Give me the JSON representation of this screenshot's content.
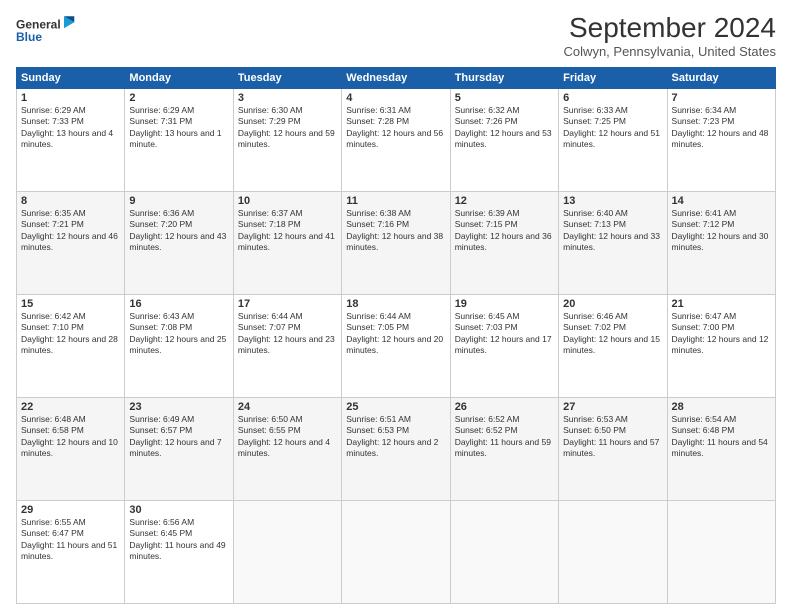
{
  "logo": {
    "line1": "General",
    "line2": "Blue"
  },
  "title": "September 2024",
  "subtitle": "Colwyn, Pennsylvania, United States",
  "days_of_week": [
    "Sunday",
    "Monday",
    "Tuesday",
    "Wednesday",
    "Thursday",
    "Friday",
    "Saturday"
  ],
  "weeks": [
    [
      {
        "day": "1",
        "sunrise": "6:29 AM",
        "sunset": "7:33 PM",
        "daylight": "13 hours and 4 minutes."
      },
      {
        "day": "2",
        "sunrise": "6:29 AM",
        "sunset": "7:31 PM",
        "daylight": "13 hours and 1 minute."
      },
      {
        "day": "3",
        "sunrise": "6:30 AM",
        "sunset": "7:29 PM",
        "daylight": "12 hours and 59 minutes."
      },
      {
        "day": "4",
        "sunrise": "6:31 AM",
        "sunset": "7:28 PM",
        "daylight": "12 hours and 56 minutes."
      },
      {
        "day": "5",
        "sunrise": "6:32 AM",
        "sunset": "7:26 PM",
        "daylight": "12 hours and 53 minutes."
      },
      {
        "day": "6",
        "sunrise": "6:33 AM",
        "sunset": "7:25 PM",
        "daylight": "12 hours and 51 minutes."
      },
      {
        "day": "7",
        "sunrise": "6:34 AM",
        "sunset": "7:23 PM",
        "daylight": "12 hours and 48 minutes."
      }
    ],
    [
      {
        "day": "8",
        "sunrise": "6:35 AM",
        "sunset": "7:21 PM",
        "daylight": "12 hours and 46 minutes."
      },
      {
        "day": "9",
        "sunrise": "6:36 AM",
        "sunset": "7:20 PM",
        "daylight": "12 hours and 43 minutes."
      },
      {
        "day": "10",
        "sunrise": "6:37 AM",
        "sunset": "7:18 PM",
        "daylight": "12 hours and 41 minutes."
      },
      {
        "day": "11",
        "sunrise": "6:38 AM",
        "sunset": "7:16 PM",
        "daylight": "12 hours and 38 minutes."
      },
      {
        "day": "12",
        "sunrise": "6:39 AM",
        "sunset": "7:15 PM",
        "daylight": "12 hours and 36 minutes."
      },
      {
        "day": "13",
        "sunrise": "6:40 AM",
        "sunset": "7:13 PM",
        "daylight": "12 hours and 33 minutes."
      },
      {
        "day": "14",
        "sunrise": "6:41 AM",
        "sunset": "7:12 PM",
        "daylight": "12 hours and 30 minutes."
      }
    ],
    [
      {
        "day": "15",
        "sunrise": "6:42 AM",
        "sunset": "7:10 PM",
        "daylight": "12 hours and 28 minutes."
      },
      {
        "day": "16",
        "sunrise": "6:43 AM",
        "sunset": "7:08 PM",
        "daylight": "12 hours and 25 minutes."
      },
      {
        "day": "17",
        "sunrise": "6:44 AM",
        "sunset": "7:07 PM",
        "daylight": "12 hours and 23 minutes."
      },
      {
        "day": "18",
        "sunrise": "6:44 AM",
        "sunset": "7:05 PM",
        "daylight": "12 hours and 20 minutes."
      },
      {
        "day": "19",
        "sunrise": "6:45 AM",
        "sunset": "7:03 PM",
        "daylight": "12 hours and 17 minutes."
      },
      {
        "day": "20",
        "sunrise": "6:46 AM",
        "sunset": "7:02 PM",
        "daylight": "12 hours and 15 minutes."
      },
      {
        "day": "21",
        "sunrise": "6:47 AM",
        "sunset": "7:00 PM",
        "daylight": "12 hours and 12 minutes."
      }
    ],
    [
      {
        "day": "22",
        "sunrise": "6:48 AM",
        "sunset": "6:58 PM",
        "daylight": "12 hours and 10 minutes."
      },
      {
        "day": "23",
        "sunrise": "6:49 AM",
        "sunset": "6:57 PM",
        "daylight": "12 hours and 7 minutes."
      },
      {
        "day": "24",
        "sunrise": "6:50 AM",
        "sunset": "6:55 PM",
        "daylight": "12 hours and 4 minutes."
      },
      {
        "day": "25",
        "sunrise": "6:51 AM",
        "sunset": "6:53 PM",
        "daylight": "12 hours and 2 minutes."
      },
      {
        "day": "26",
        "sunrise": "6:52 AM",
        "sunset": "6:52 PM",
        "daylight": "11 hours and 59 minutes."
      },
      {
        "day": "27",
        "sunrise": "6:53 AM",
        "sunset": "6:50 PM",
        "daylight": "11 hours and 57 minutes."
      },
      {
        "day": "28",
        "sunrise": "6:54 AM",
        "sunset": "6:48 PM",
        "daylight": "11 hours and 54 minutes."
      }
    ],
    [
      {
        "day": "29",
        "sunrise": "6:55 AM",
        "sunset": "6:47 PM",
        "daylight": "11 hours and 51 minutes."
      },
      {
        "day": "30",
        "sunrise": "6:56 AM",
        "sunset": "6:45 PM",
        "daylight": "11 hours and 49 minutes."
      },
      null,
      null,
      null,
      null,
      null
    ]
  ],
  "labels": {
    "sunrise": "Sunrise:",
    "sunset": "Sunset:",
    "daylight": "Daylight:"
  }
}
